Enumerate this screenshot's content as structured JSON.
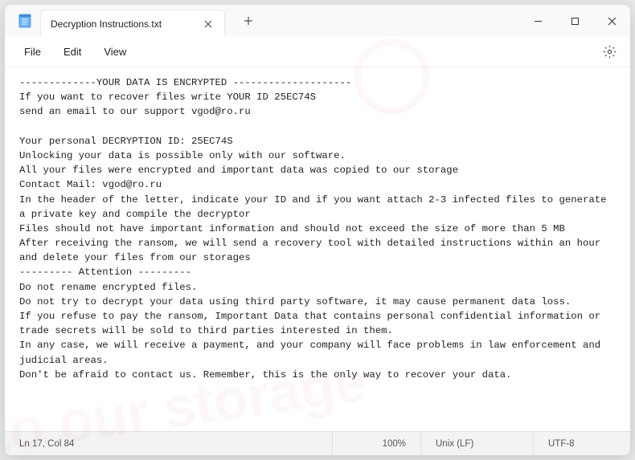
{
  "window": {
    "app_name": "Notepad"
  },
  "tab": {
    "title": "Decryption Instructions.txt"
  },
  "menu": {
    "file": "File",
    "edit": "Edit",
    "view": "View"
  },
  "document": {
    "content": "-------------YOUR DATA IS ENCRYPTED --------------------\nIf you want to recover files write YOUR ID 25EC74S\nsend an email to our support vgod@ro.ru\n\nYour personal DECRYPTION ID: 25EC74S\nUnlocking your data is possible only with our software.\nAll your files were encrypted and important data was copied to our storage\nContact Mail: vgod@ro.ru\nIn the header of the letter, indicate your ID and if you want attach 2-3 infected files to generate a private key and compile the decryptor\nFiles should not have important information and should not exceed the size of more than 5 MB\nAfter receiving the ransom, we will send a recovery tool with detailed instructions within an hour and delete your files from our storages\n--------- Attention ---------\nDo not rename encrypted files.\nDo not try to decrypt your data using third party software, it may cause permanent data loss.\nIf you refuse to pay the ransom, Important Data that contains personal confidential information or trade secrets will be sold to third parties interested in them.\nIn any case, we will receive a payment, and your company will face problems in law enforcement and judicial areas.\nDon't be afraid to contact us. Remember, this is the only way to recover your data."
  },
  "statusbar": {
    "position": "Ln 17, Col 84",
    "zoom": "100%",
    "eol": "Unix (LF)",
    "encoding": "UTF-8"
  },
  "colors": {
    "window_bg": "#ffffff",
    "titlebar_bg": "#f9f9f9",
    "status_bg": "#f3f3f3",
    "text": "#222222"
  }
}
